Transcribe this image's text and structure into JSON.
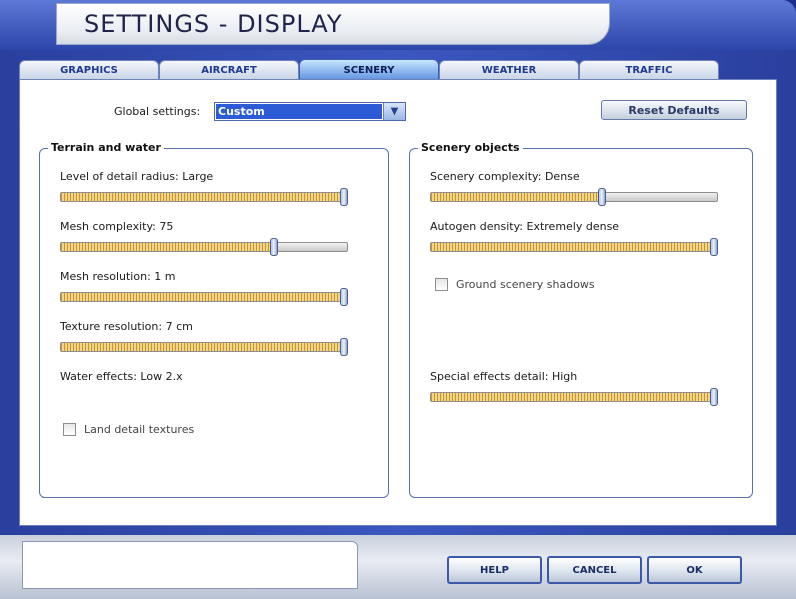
{
  "window": {
    "title": "SETTINGS - DISPLAY"
  },
  "tabs": [
    {
      "label": "GRAPHICS"
    },
    {
      "label": "AIRCRAFT"
    },
    {
      "label": "SCENERY",
      "active": true
    },
    {
      "label": "WEATHER"
    },
    {
      "label": "TRAFFIC"
    }
  ],
  "global": {
    "label": "Global settings:",
    "value": "Custom",
    "reset_label": "Reset Defaults"
  },
  "terrain": {
    "title": "Terrain and water",
    "level_of_detail_label": "Level of detail radius: Large",
    "level_of_detail_level": 1.0,
    "mesh_complexity_label": "Mesh complexity: 75",
    "mesh_complexity_level": 0.75,
    "mesh_resolution_label": "Mesh resolution: 1 m",
    "mesh_resolution_level": 1.0,
    "texture_resolution_label": "Texture resolution: 7 cm",
    "texture_resolution_level": 1.0,
    "water_effects_label": "Water effects: Low 2.x",
    "land_detail_label": "Land detail textures",
    "land_detail_checked": false
  },
  "scenery": {
    "title": "Scenery objects",
    "complexity_label": "Scenery complexity: Dense",
    "complexity_level": 0.6,
    "autogen_label": "Autogen density: Extremely dense",
    "autogen_level": 1.0,
    "ground_shadows_label": "Ground scenery shadows",
    "ground_shadows_checked": false,
    "special_effects_label": "Special effects detail: High",
    "special_effects_level": 1.0
  },
  "buttons": {
    "help": "HELP",
    "cancel": "CANCEL",
    "ok": "OK"
  },
  "colors": {
    "frame_blue": "#2c46aa",
    "slider_fill": "#e6c26a",
    "selected_blue": "#2d5bd5"
  }
}
